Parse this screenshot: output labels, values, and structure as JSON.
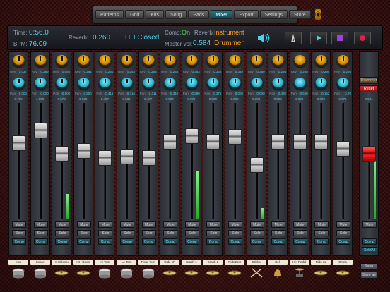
{
  "nav": {
    "tabs": [
      "Patterns",
      "Grid",
      "Kits",
      "Song",
      "Pads",
      "Mixer",
      "Export",
      "Settings",
      "Store"
    ],
    "active": "Mixer"
  },
  "info": {
    "time_label": "Time:",
    "time_value": "0:56.0",
    "bpm_label": "BPM:",
    "bpm_value": "76.09",
    "reverb_label": "Reverb:",
    "reverb_value": "0.260",
    "selected_channel": "HH Closed",
    "comp_label": "Comp:",
    "comp_value": "On",
    "reverb_mode_label": "Reverb:",
    "reverb_mode_value": "Instrument",
    "master_label": "Master vol:",
    "master_value": "0.584",
    "drummer_value": "Drummer"
  },
  "colors": {
    "accent": "#4fd0e8",
    "orange": "#ffa020",
    "green": "#55dd55",
    "record": "#e0204a",
    "stop": "#a040e0"
  },
  "channels": [
    {
      "name": "Kick",
      "rev": "0.037",
      "pan": "0.000",
      "vol": "0.769",
      "fader": 0.77,
      "meter": 0,
      "icon": "drum"
    },
    {
      "name": "Snare",
      "rev": "0.289",
      "pan": "0.000",
      "vol": "1.000",
      "fader": 1.0,
      "meter": 0,
      "icon": "drum"
    },
    {
      "name": "HH Closed",
      "rev": "0.086",
      "pan": "-0.500",
      "vol": "0.578",
      "fader": 0.58,
      "meter": 0.22,
      "icon": "cymbal"
    },
    {
      "name": "HH Open",
      "rev": "0.291",
      "pan": "-0.500",
      "vol": "0.628",
      "fader": 0.63,
      "meter": 0,
      "icon": "cymbal"
    },
    {
      "name": "Hi Tom",
      "rev": "0.250",
      "pan": "-0.416",
      "vol": "0.497",
      "fader": 0.5,
      "meter": 0,
      "icon": "drum"
    },
    {
      "name": "Lo Tom",
      "rev": "0.253",
      "pan": "-0.416",
      "vol": "0.531",
      "fader": 0.53,
      "meter": 0,
      "icon": "drum"
    },
    {
      "name": "Floor Tom",
      "rev": "0.253",
      "pan": "0.411",
      "vol": "0.497",
      "fader": 0.5,
      "meter": 0,
      "icon": "drum"
    },
    {
      "name": "Ride cF",
      "rev": "0.253",
      "pan": "-0.340",
      "vol": "0.800",
      "fader": 0.8,
      "meter": 0,
      "icon": "cymbal"
    },
    {
      "name": "Crash 1",
      "rev": "0.353",
      "pan": "-0.380",
      "vol": "0.900",
      "fader": 0.9,
      "meter": 0.42,
      "icon": "cymbal"
    },
    {
      "name": "Crash 2",
      "rev": "0.336",
      "pan": "0.375",
      "vol": "0.800",
      "fader": 0.8,
      "meter": 0,
      "icon": "cymbal"
    },
    {
      "name": "Ride2oH",
      "rev": "0.349",
      "pan": "0.000",
      "vol": "0.882",
      "fader": 0.88,
      "meter": 0,
      "icon": "cymbal"
    },
    {
      "name": "Sticks",
      "rev": "0.350",
      "pan": "0.000",
      "vol": "0.384",
      "fader": 0.38,
      "meter": 0.1,
      "icon": "sticks"
    },
    {
      "name": "Bell",
      "rev": "0.294",
      "pan": "0.430",
      "vol": "0.800",
      "fader": 0.8,
      "meter": 0,
      "icon": "bell"
    },
    {
      "name": "HH Pedal",
      "rev": "0.298",
      "pan": "-0.500",
      "vol": "0.800",
      "fader": 0.8,
      "meter": 0,
      "icon": "pedal"
    },
    {
      "name": "Ride 2d",
      "rev": "0.294",
      "pan": "0.152",
      "vol": "0.800",
      "fader": 0.8,
      "meter": 0,
      "icon": "cymbal"
    },
    {
      "name": "China",
      "rev": "0.286",
      "pan": "0.70",
      "vol": "0.671",
      "fader": 0.67,
      "meter": 0,
      "icon": "cymbal"
    }
  ],
  "master": {
    "vol": "0.584",
    "fader": 0.58,
    "meter": 0.55
  },
  "strip_labels": {
    "mute": "Mute",
    "solo": "Solo",
    "comp": "Comp",
    "rev_prefix": "Rev",
    "pan_prefix": "Pan"
  },
  "side": {
    "drummer": "Drummer",
    "reset": "Reset",
    "comp": "Comp",
    "settings": "Sett/All",
    "save": "Save",
    "save_as": "Save as"
  }
}
